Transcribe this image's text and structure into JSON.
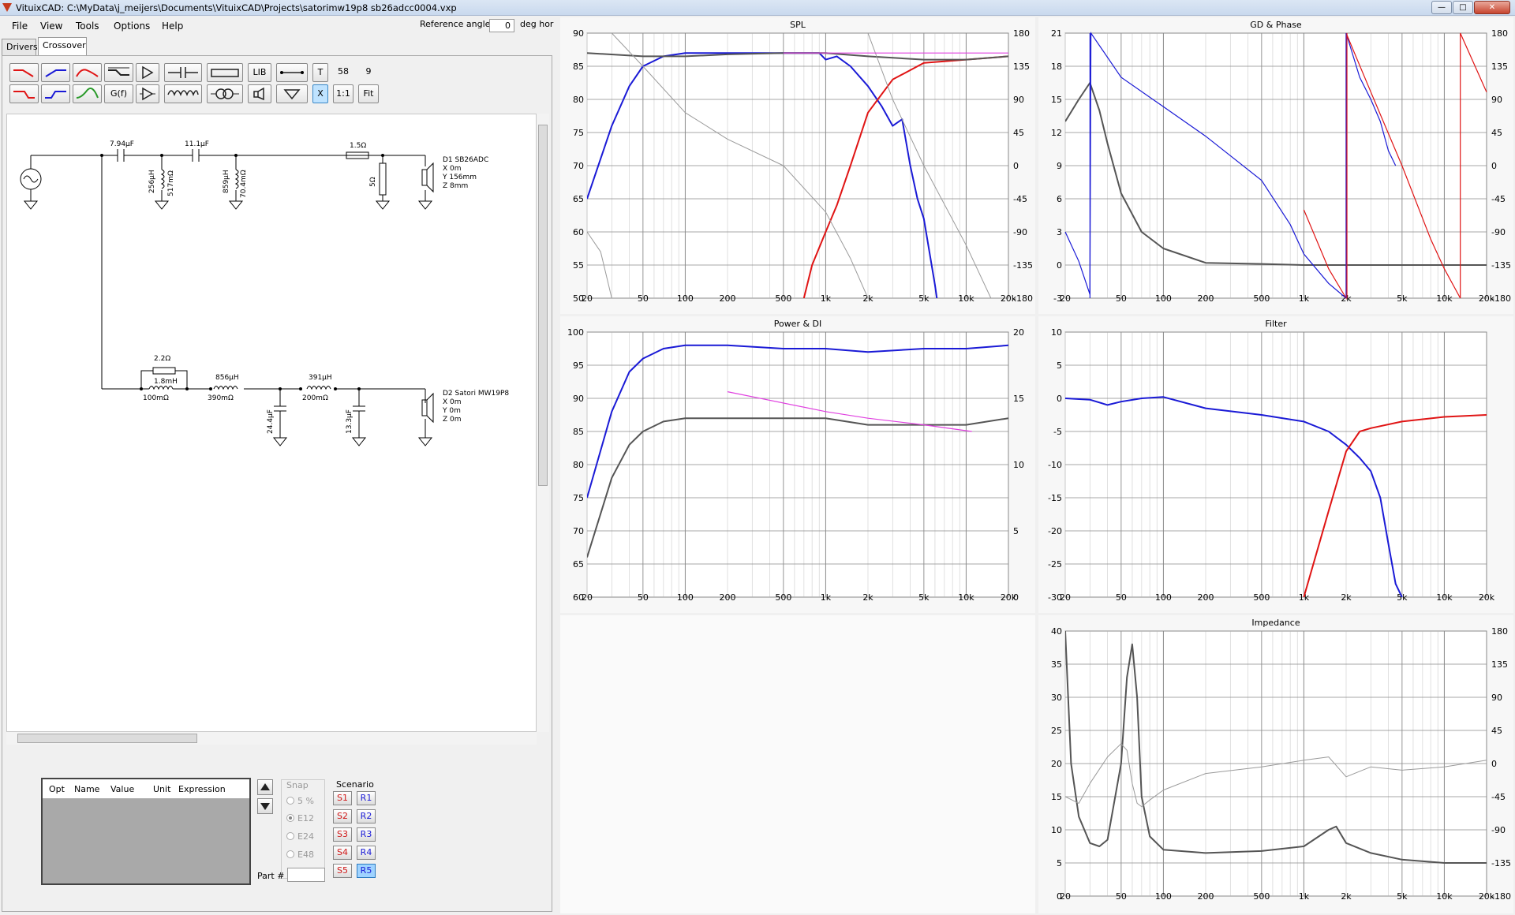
{
  "window": {
    "title": "VituixCAD: C:\\MyData\\j_meijers\\Documents\\VituixCAD\\Projects\\satorimw19p8 sb26adcc0004.vxp"
  },
  "menu": [
    "File",
    "View",
    "Tools",
    "Options",
    "Help"
  ],
  "reference": {
    "label": "Reference angle",
    "value": "0",
    "unit": "deg hor"
  },
  "tabs": [
    {
      "label": "Drivers"
    },
    {
      "label": "Crossover"
    }
  ],
  "toolbar": {
    "lib": "LIB",
    "t": "T",
    "count1": "58",
    "count2": "9",
    "gf": "G(f)",
    "x": "X",
    "ratio": "1:1",
    "fit": "Fit"
  },
  "schematic": {
    "c1": "7.94µF",
    "c2": "11.1µF",
    "r1": "1.5Ω",
    "l1a": "256µH",
    "l1b": "517mΩ",
    "l2a": "859µH",
    "l2b": "70.4mΩ",
    "r2": "5Ω",
    "d1": [
      "D1 SB26ADC",
      "X 0m",
      "Y 156mm",
      "Z 8mm"
    ],
    "r3": "2.2Ω",
    "l3a": "1.8mH",
    "l3b": "100mΩ",
    "l4a": "856µH",
    "l4b": "390mΩ",
    "l5a": "391µH",
    "l5b": "200mΩ",
    "c3": "24.4µF",
    "c4": "13.3µF",
    "d2": [
      "D2 Satori MW19P8",
      "X 0m",
      "Y 0m",
      "Z 0m"
    ]
  },
  "params": {
    "headers": [
      "Opt",
      "Name",
      "Value",
      "Unit",
      "Expression"
    ]
  },
  "snap": {
    "title": "Snap",
    "options": [
      "5 %",
      "E12",
      "E24",
      "E48"
    ],
    "selected": "E12"
  },
  "scenario": {
    "title": "Scenario",
    "s": [
      "S1",
      "S2",
      "S3",
      "S4",
      "S5"
    ],
    "r": [
      "R1",
      "R2",
      "R3",
      "R4",
      "R5"
    ],
    "active": "R5"
  },
  "part": {
    "label": "Part #"
  },
  "colors": {
    "blue": "#1a1ad6",
    "red": "#e01414",
    "gray": "#555555",
    "light": "#9a9a9a",
    "magenta": "#e040e0",
    "green": "#2a9a2a"
  },
  "xticks": [
    "20",
    "50",
    "100",
    "200",
    "500",
    "1k",
    "2k",
    "5k",
    "10k",
    "20k"
  ],
  "plots": {
    "spl": {
      "title": "SPL",
      "yl": [
        "90",
        "85",
        "80",
        "75",
        "70",
        "65",
        "60",
        "55",
        "50"
      ],
      "yr": [
        "180",
        "135",
        "90",
        "45",
        "0",
        "-45",
        "-90",
        "-135",
        "-180"
      ]
    },
    "gd": {
      "title": "GD & Phase",
      "yl": [
        "21",
        "18",
        "15",
        "12",
        "9",
        "6",
        "3",
        "0",
        "-3"
      ],
      "yr": [
        "180",
        "135",
        "90",
        "45",
        "0",
        "-45",
        "-90",
        "-135",
        "-180"
      ]
    },
    "pdi": {
      "title": "Power & DI",
      "yl": [
        "100",
        "95",
        "90",
        "85",
        "80",
        "75",
        "70",
        "65",
        "60"
      ],
      "yr": [
        "20",
        "",
        "15",
        "",
        "10",
        "",
        "5",
        "",
        "0"
      ]
    },
    "filter": {
      "title": "Filter",
      "yl": [
        "10",
        "5",
        "0",
        "-5",
        "-10",
        "-15",
        "-20",
        "-25",
        "-30"
      ]
    },
    "imp": {
      "title": "Impedance",
      "yl": [
        "40",
        "35",
        "30",
        "25",
        "20",
        "15",
        "10",
        "5",
        "0"
      ],
      "yr": [
        "180",
        "135",
        "90",
        "45",
        "0",
        "-45",
        "-90",
        "-135",
        "-180"
      ]
    }
  },
  "chart_data": [
    {
      "type": "line",
      "title": "SPL",
      "x_scale": "log",
      "xlim": [
        20,
        20000
      ],
      "ylim": [
        50,
        90
      ],
      "y2lim": [
        -180,
        180
      ],
      "series": [
        {
          "color": "blue",
          "x": [
            20,
            30,
            40,
            50,
            70,
            100,
            200,
            500,
            900,
            1000,
            1200,
            1500,
            2000,
            2500,
            3000,
            3500,
            4000,
            4500,
            5000,
            6000,
            7000
          ],
          "y": [
            65,
            76,
            82,
            85,
            86.5,
            87,
            87,
            87,
            87,
            86,
            86.5,
            85,
            82,
            79,
            76,
            77,
            70,
            65,
            62,
            52,
            42
          ]
        },
        {
          "color": "red",
          "x": [
            700,
            800,
            1000,
            1200,
            1500,
            2000,
            3000,
            5000,
            10000,
            20000
          ],
          "y": [
            50,
            55,
            60,
            64,
            70,
            78,
            83,
            85.5,
            86,
            86.5
          ]
        },
        {
          "color": "gray",
          "x": [
            20,
            50,
            100,
            200,
            500,
            1000,
            2000,
            5000,
            10000,
            20000
          ],
          "y": [
            87,
            86.5,
            86.5,
            86.8,
            87,
            87,
            86.5,
            86,
            86,
            86.5
          ]
        },
        {
          "color": "light",
          "x": [
            30,
            50,
            100,
            200,
            500,
            1000,
            1500,
            2000
          ],
          "y": [
            90,
            85,
            78,
            74,
            70,
            63,
            56,
            50
          ]
        },
        {
          "color": "light",
          "x": [
            2000,
            3000,
            5000,
            10000,
            15000
          ],
          "y": [
            90,
            80,
            70,
            58,
            50
          ]
        },
        {
          "color": "light",
          "x": [
            20,
            25,
            30
          ],
          "y": [
            60,
            57,
            50
          ]
        }
      ]
    },
    {
      "type": "line",
      "title": "GD & Phase",
      "x_scale": "log",
      "xlim": [
        20,
        20000
      ],
      "ylim": [
        -3,
        21
      ],
      "y2lim": [
        -180,
        180
      ],
      "series": [
        {
          "color": "gray",
          "x": [
            20,
            25,
            30,
            35,
            40,
            50,
            70,
            100,
            200,
            500,
            1000,
            2000,
            5000,
            20000
          ],
          "y": [
            13,
            15,
            16.5,
            14,
            11,
            6.5,
            3,
            1.5,
            0.2,
            0.1,
            0,
            0,
            0,
            0
          ]
        }
      ]
    },
    {
      "type": "line",
      "title": "Power & DI",
      "x_scale": "log",
      "xlim": [
        20,
        20000
      ],
      "ylim": [
        60,
        100
      ],
      "y2lim": [
        0,
        20
      ],
      "series": [
        {
          "color": "blue",
          "x": [
            20,
            30,
            40,
            50,
            70,
            100,
            200,
            500,
            1000,
            2000,
            5000,
            10000,
            20000
          ],
          "y": [
            75,
            88,
            94,
            96,
            97.5,
            98,
            98,
            97.5,
            97.5,
            97,
            97.5,
            97.5,
            98
          ]
        },
        {
          "color": "gray",
          "x": [
            20,
            30,
            40,
            50,
            70,
            100,
            200,
            500,
            1000,
            2000,
            5000,
            10000,
            20000
          ],
          "y": [
            66,
            78,
            83,
            85,
            86.5,
            87,
            87,
            87,
            87,
            86,
            86,
            86,
            87
          ]
        },
        {
          "color": "magenta",
          "x": [
            200,
            1000,
            2000,
            5000,
            11000
          ],
          "y": [
            91,
            88,
            87,
            86,
            85
          ]
        }
      ]
    },
    {
      "type": "line",
      "title": "Filter",
      "x_scale": "log",
      "xlim": [
        20,
        20000
      ],
      "ylim": [
        -30,
        10
      ],
      "series": [
        {
          "color": "blue",
          "x": [
            20,
            30,
            40,
            50,
            70,
            100,
            200,
            500,
            1000,
            1500,
            2000,
            2500,
            3000,
            3500,
            4000,
            4500,
            5000
          ],
          "y": [
            0,
            -0.2,
            -1,
            -0.5,
            0,
            0.2,
            -1.5,
            -2.5,
            -3.5,
            -5,
            -7,
            -9,
            -11,
            -15,
            -22,
            -28,
            -30
          ]
        },
        {
          "color": "red",
          "x": [
            1000,
            1500,
            2000,
            2500,
            3000,
            5000,
            10000,
            20000
          ],
          "y": [
            -30,
            -17,
            -8,
            -5,
            -4.5,
            -3.5,
            -2.8,
            -2.5
          ]
        }
      ]
    },
    {
      "type": "line",
      "title": "Impedance",
      "x_scale": "log",
      "xlim": [
        20,
        20000
      ],
      "ylim": [
        0,
        40
      ],
      "y2lim": [
        -180,
        180
      ],
      "series": [
        {
          "color": "gray",
          "x": [
            20,
            22,
            25,
            30,
            35,
            40,
            50,
            55,
            60,
            65,
            70,
            80,
            100,
            200,
            500,
            1000,
            1500,
            1700,
            2000,
            3000,
            5000,
            10000,
            20000
          ],
          "y": [
            40,
            20,
            12,
            8,
            7.5,
            8.5,
            20,
            33,
            38,
            30,
            15,
            9,
            7,
            6.5,
            6.8,
            7.5,
            10,
            10.5,
            8,
            6.5,
            5.5,
            5,
            5
          ]
        },
        {
          "color": "light",
          "x": [
            20,
            25,
            30,
            40,
            50,
            55,
            60,
            65,
            70,
            80,
            100,
            200,
            500,
            1000,
            1500,
            2000,
            3000,
            5000,
            10000,
            20000
          ],
          "y": [
            15,
            14,
            17,
            21,
            23,
            22,
            17,
            14,
            13.5,
            14.5,
            16,
            18.5,
            19.5,
            20.5,
            21,
            18,
            19.5,
            19,
            19.5,
            20.5
          ]
        }
      ]
    }
  ]
}
